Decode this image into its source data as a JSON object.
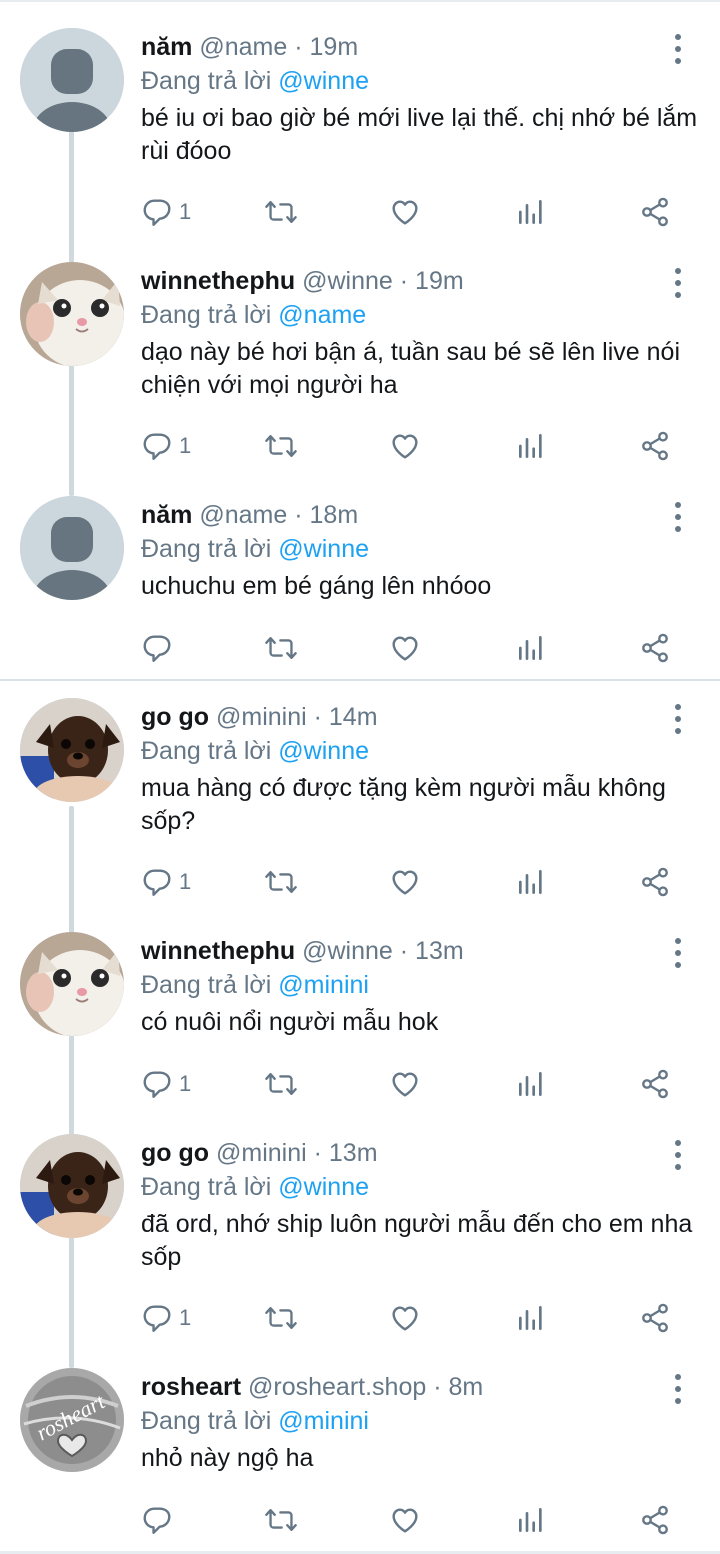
{
  "tweets": [
    {
      "name": "năm",
      "handle": "@name",
      "time": "19m",
      "reply_prefix": "Đang trả lời",
      "reply_to": "@winne",
      "text": "bé iu ơi bao giờ bé mới live lại thế. chị nhớ bé lắm rùi đóoo",
      "reply_count": "1",
      "avatar_icon": "default-profile-icon"
    },
    {
      "name": "winnethephu",
      "handle": "@winne",
      "time": "19m",
      "reply_prefix": "Đang trả lời",
      "reply_to": "@name",
      "text": "dạo này bé hơi bận á, tuần sau bé sẽ lên live nói chiện với mọi người ha",
      "reply_count": "1",
      "avatar_icon": "cat-photo-avatar"
    },
    {
      "name": "năm",
      "handle": "@name",
      "time": "18m",
      "reply_prefix": "Đang trả lời",
      "reply_to": "@winne",
      "text": "uchuchu em bé gáng lên nhóoo",
      "reply_count": "",
      "avatar_icon": "default-profile-icon"
    },
    {
      "name": "go go",
      "handle": "@minini",
      "time": "14m",
      "reply_prefix": "Đang trả lời",
      "reply_to": "@winne",
      "text": "mua hàng có được tặng kèm người mẫu không sốp?",
      "reply_count": "1",
      "avatar_icon": "dog-photo-avatar"
    },
    {
      "name": "winnethephu",
      "handle": "@winne",
      "time": "13m",
      "reply_prefix": "Đang trả lời",
      "reply_to": "@minini",
      "text": "có nuôi nổi người mẫu hok",
      "reply_count": "1",
      "avatar_icon": "cat-photo-avatar"
    },
    {
      "name": "go go",
      "handle": "@minini",
      "time": "13m",
      "reply_prefix": "Đang trả lời",
      "reply_to": "@winne",
      "text": "đã ord, nhớ ship luôn người mẫu đến cho em nha sốp",
      "reply_count": "1",
      "avatar_icon": "dog-photo-avatar"
    },
    {
      "name": "rosheart",
      "handle": "@rosheart.shop",
      "time": "8m",
      "reply_prefix": "Đang trả lời",
      "reply_to": "@minini",
      "text": "nhỏ này ngộ ha",
      "reply_count": "",
      "avatar_icon": "rosheart-logo-avatar",
      "avatar_text": "rosheart"
    }
  ],
  "separator_dot": "·",
  "colors": {
    "mention": "#1da1f2",
    "secondary_text": "#657786",
    "primary_text": "#14171a",
    "thread_line": "#cfd9de"
  }
}
